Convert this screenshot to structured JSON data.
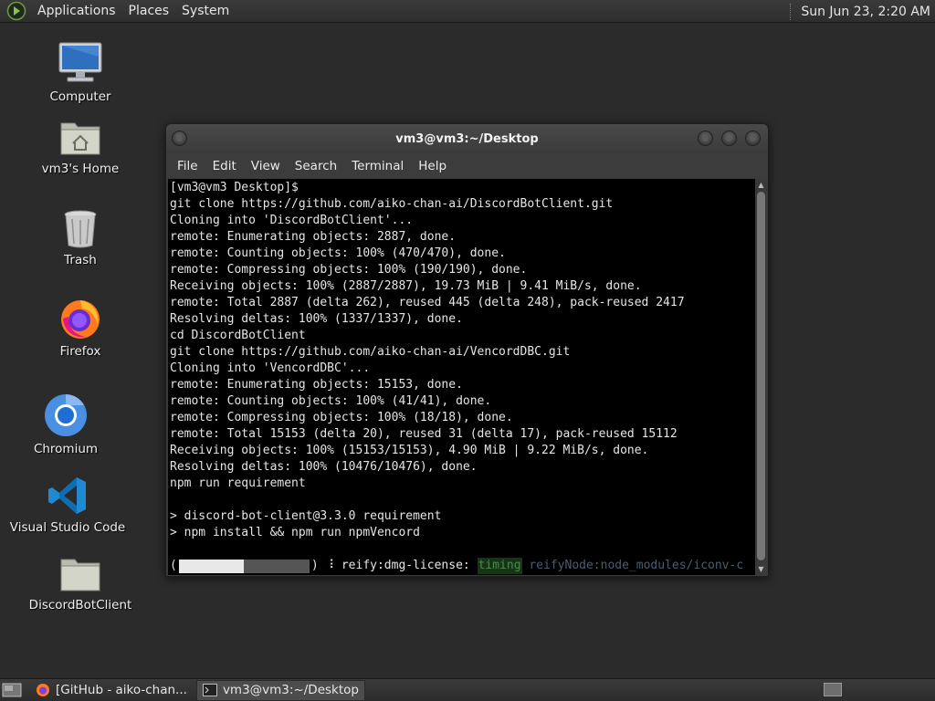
{
  "top_panel": {
    "menus": [
      "Applications",
      "Places",
      "System"
    ],
    "clock": "Sun Jun 23,  2:20 AM"
  },
  "desktop": {
    "icons": [
      {
        "label": "Computer",
        "icon": "computer-icon"
      },
      {
        "label": "vm3's Home",
        "icon": "home-folder-icon"
      },
      {
        "label": "Trash",
        "icon": "trash-icon"
      },
      {
        "label": "Firefox",
        "icon": "firefox-icon"
      },
      {
        "label": "Chromium",
        "icon": "chromium-icon"
      },
      {
        "label": "Visual Studio Code",
        "icon": "vscode-icon"
      },
      {
        "label": "DiscordBotClient",
        "icon": "folder-icon"
      }
    ]
  },
  "terminal": {
    "title": "vm3@vm3:~/Desktop",
    "menu": [
      "File",
      "Edit",
      "View",
      "Search",
      "Terminal",
      "Help"
    ],
    "lines": [
      "[vm3@vm3 Desktop]$",
      "git clone https://github.com/aiko-chan-ai/DiscordBotClient.git",
      "Cloning into 'DiscordBotClient'...",
      "remote: Enumerating objects: 2887, done.",
      "remote: Counting objects: 100% (470/470), done.",
      "remote: Compressing objects: 100% (190/190), done.",
      "Receiving objects: 100% (2887/2887), 19.73 MiB | 9.41 MiB/s, done.",
      "remote: Total 2887 (delta 262), reused 445 (delta 248), pack-reused 2417",
      "Resolving deltas: 100% (1337/1337), done.",
      "cd DiscordBotClient",
      "git clone https://github.com/aiko-chan-ai/VencordDBC.git",
      "Cloning into 'VencordDBC'...",
      "remote: Enumerating objects: 15153, done.",
      "remote: Counting objects: 100% (41/41), done.",
      "remote: Compressing objects: 100% (18/18), done.",
      "remote: Total 15153 (delta 20), reused 31 (delta 17), pack-reused 15112",
      "Receiving objects: 100% (15153/15153), 4.90 MiB | 9.22 MiB/s, done.",
      "Resolving deltas: 100% (10476/10476), done.",
      "npm run requirement",
      "",
      "> discord-bot-client@3.3.0 requirement",
      "> npm install && npm run npmVencord",
      ""
    ],
    "progress": {
      "open": "(",
      "fraction": 0.5,
      "close": ")",
      "spinner": "⠸",
      "stage": "reify:dmg-license:",
      "tag": "timing",
      "detail": "reifyNode:node_modules/iconv-c"
    }
  },
  "taskbar": {
    "tasks": [
      {
        "label": "[GitHub - aiko-chan...",
        "icon": "firefox-icon",
        "active": false
      },
      {
        "label": "vm3@vm3:~/Desktop",
        "icon": "terminal-icon",
        "active": true
      }
    ]
  }
}
